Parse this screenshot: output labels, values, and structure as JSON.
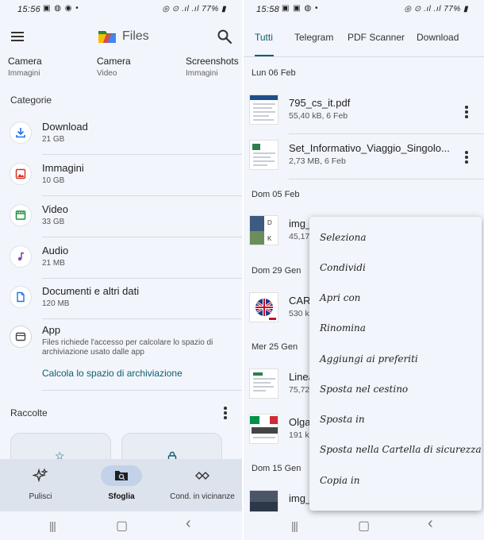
{
  "left": {
    "status": {
      "time": "15:56",
      "icons_left": "▣ ◍ ◉ •",
      "icons_right": "◎ ⊙ .ıl .ıl 77% ▮"
    },
    "app": {
      "title": "Files"
    },
    "quick_access": [
      {
        "label": "Camera",
        "sub": "Immagini"
      },
      {
        "label": "Camera",
        "sub": "Video"
      },
      {
        "label": "Screenshots",
        "sub": "Immagini"
      }
    ],
    "categories_heading": "Categorie",
    "categories": [
      {
        "name": "Download",
        "size": "21 GB",
        "icon": "download-icon",
        "color": "#1a73e8"
      },
      {
        "name": "Immagini",
        "size": "10 GB",
        "icon": "image-icon",
        "color": "#d93025"
      },
      {
        "name": "Video",
        "size": "33 GB",
        "icon": "video-icon",
        "color": "#1e8e3e"
      },
      {
        "name": "Audio",
        "size": "21 MB",
        "icon": "music-icon",
        "color": "#8e44ad"
      },
      {
        "name": "Documenti e altri dati",
        "size": "120 MB",
        "icon": "document-icon",
        "color": "#1a73e8"
      }
    ],
    "app_item": {
      "name": "App",
      "description": "Files richiede l'accesso per calcolare lo spazio di archiviazione usato dalle app",
      "link": "Calcola lo spazio di archiviazione"
    },
    "collections_heading": "Raccolte",
    "bottom_nav": [
      {
        "label": "Pulisci",
        "icon": "sparkle-icon",
        "active": false
      },
      {
        "label": "Sfoglia",
        "icon": "browse-icon",
        "active": true
      },
      {
        "label": "Cond. in vicinanze",
        "icon": "nearby-share-icon",
        "active": false
      }
    ],
    "system_nav": {
      "recents": "|||",
      "home": "▢",
      "back": "‹"
    }
  },
  "right": {
    "status": {
      "time": "15:58",
      "icons_left": "▣ ▣ ◍ •",
      "icons_right": "◎ ⊙ .ıl .ıl 77% ▮"
    },
    "tabs": [
      "Tutti",
      "Telegram",
      "PDF Scanner",
      "Download"
    ],
    "active_tab": 0,
    "groups": [
      {
        "date": "Lun 06 Feb",
        "files": [
          {
            "name": "795_cs_it.pdf",
            "meta": "55,40 kB, 6 Feb"
          },
          {
            "name": "Set_Informativo_Viaggio_Singolo...",
            "meta": "2,73 MB, 6 Feb"
          }
        ]
      },
      {
        "date": "Dom 05 Feb",
        "files": [
          {
            "name": "img_",
            "meta": "45,17"
          }
        ]
      },
      {
        "date": "Dom 29 Gen",
        "files": [
          {
            "name": "CAR",
            "meta": "530 k"
          }
        ]
      },
      {
        "date": "Mer 25 Gen",
        "files": [
          {
            "name": "Linea",
            "meta": "75,72"
          },
          {
            "name": "Olga",
            "meta": "191 kE"
          }
        ]
      },
      {
        "date": "Dom 15 Gen",
        "files": [
          {
            "name": "img_",
            "meta": ""
          }
        ]
      }
    ],
    "context_menu": [
      "Seleziona",
      "Condividi",
      "Apri con",
      "Rinomina",
      "Aggiungi ai preferiti",
      "Sposta nel cestino",
      "Sposta in",
      "Sposta nella Cartella di sicurezza",
      "Copia in"
    ],
    "system_nav": {
      "recents": "|||",
      "home": "▢",
      "back": "‹"
    }
  }
}
